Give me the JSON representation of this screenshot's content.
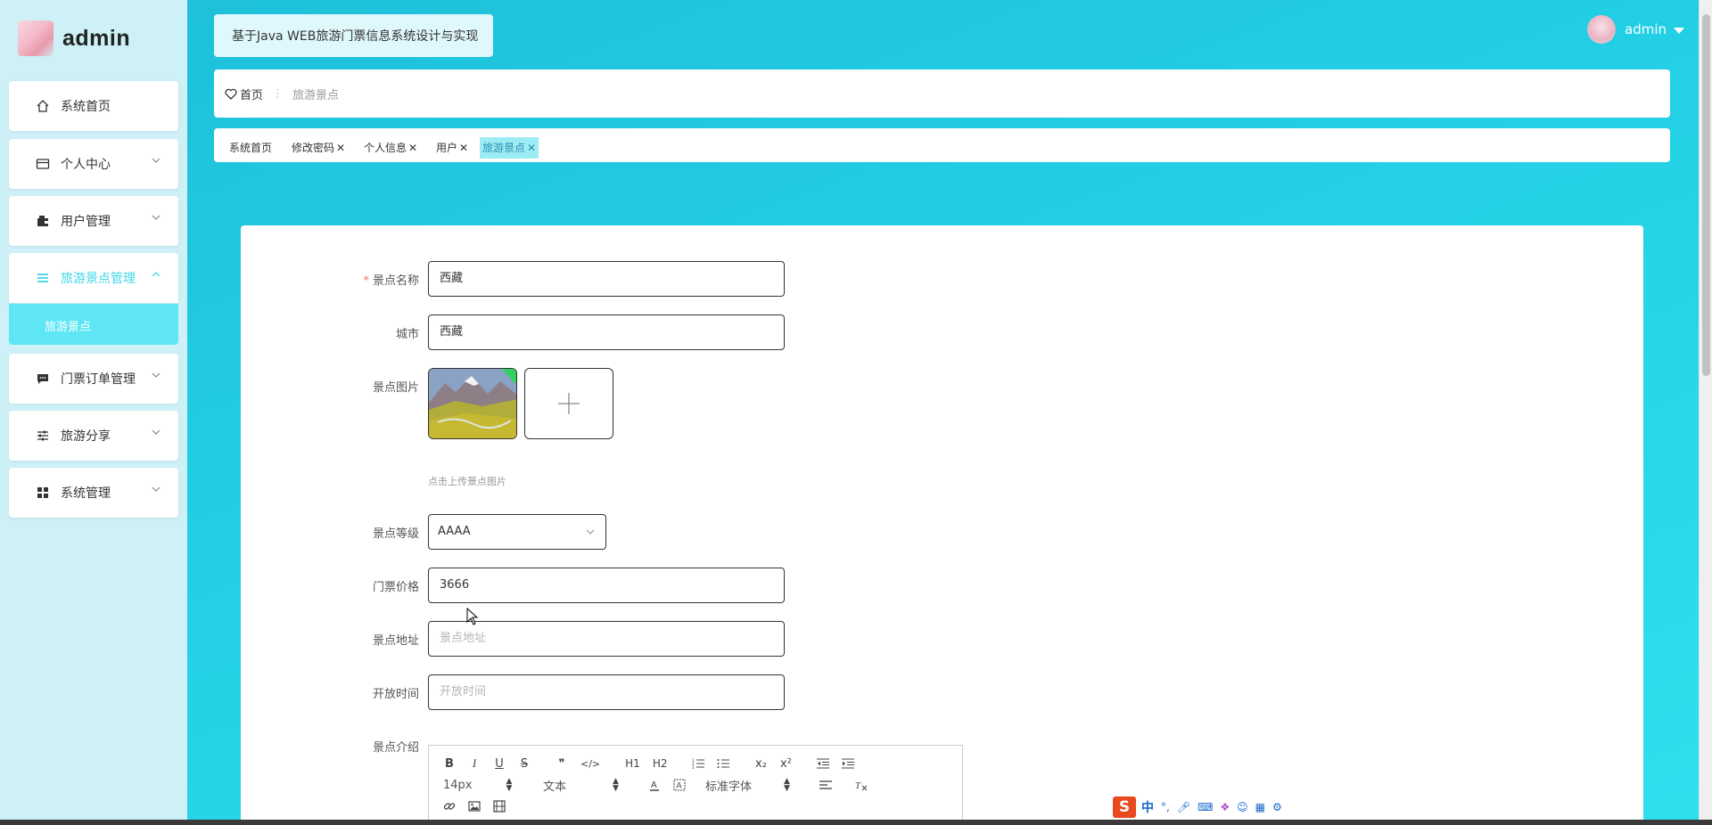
{
  "sidebar": {
    "brand": "admin",
    "menu": [
      {
        "label": "系统首页",
        "icon": "home-icon",
        "expandable": false
      },
      {
        "label": "个人中心",
        "icon": "card-icon",
        "expandable": true
      },
      {
        "label": "用户管理",
        "icon": "wallet-icon",
        "expandable": true
      },
      {
        "label": "旅游景点管理",
        "icon": "list-icon",
        "expandable": true,
        "expanded": true,
        "active": true
      },
      {
        "label": "门票订单管理",
        "icon": "chat-icon",
        "expandable": true
      },
      {
        "label": "旅游分享",
        "icon": "sliders-icon",
        "expandable": true
      },
      {
        "label": "系统管理",
        "icon": "grid-icon",
        "expandable": true
      }
    ],
    "submenu_item": "旅游景点"
  },
  "header": {
    "title": "基于Java WEB旅游门票信息系统设计与实现",
    "user": "admin"
  },
  "breadcrumb": {
    "home": "首页",
    "current": "旅游景点"
  },
  "tags": [
    {
      "label": "系统首页",
      "closable": false
    },
    {
      "label": "修改密码",
      "closable": true
    },
    {
      "label": "个人信息",
      "closable": true
    },
    {
      "label": "用户",
      "closable": true
    },
    {
      "label": "旅游景点",
      "closable": true,
      "active": true
    }
  ],
  "form": {
    "name": {
      "label": "景点名称",
      "required": true,
      "value": "西藏"
    },
    "city": {
      "label": "城市",
      "value": "西藏"
    },
    "image": {
      "label": "景点图片",
      "hint": "点击上传景点图片"
    },
    "level": {
      "label": "景点等级",
      "value": "AAAA"
    },
    "price": {
      "label": "门票价格",
      "value": "3666"
    },
    "address": {
      "label": "景点地址",
      "placeholder": "景点地址"
    },
    "open_time": {
      "label": "开放时间",
      "placeholder": "开放时间"
    },
    "intro": {
      "label": "景点介绍"
    }
  },
  "editor": {
    "row1": [
      "B",
      "I",
      "U",
      "S",
      "❞",
      "</>",
      "H1",
      "H2",
      "ol",
      "ul",
      "x₂",
      "x²",
      "outdent",
      "indent"
    ],
    "font_size": "14px",
    "block": "文本",
    "font_family": "标准字体"
  },
  "ime": {
    "lang": "中",
    "punct": "°,"
  },
  "colors": {
    "accent": "#1fc6dc",
    "sidebar_bg": "#cdf1f7",
    "active_text": "#3fd6ea",
    "submenu_bg": "#5ee6f5"
  }
}
